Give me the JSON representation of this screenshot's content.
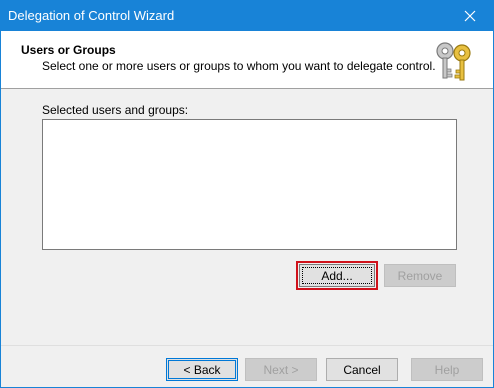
{
  "window": {
    "title": "Delegation of Control Wizard"
  },
  "header": {
    "title": "Users or Groups",
    "subtitle": "Select one or more users or groups to whom you want to delegate control.",
    "icon": "keys-icon"
  },
  "main": {
    "list_label": "Selected users and groups:",
    "list_items": []
  },
  "buttons": {
    "add": "Add...",
    "remove": "Remove",
    "back": "< Back",
    "next": "Next >",
    "cancel": "Cancel",
    "help": "Help"
  },
  "colors": {
    "titlebar": "#1883d7",
    "highlight": "#d0121b"
  }
}
